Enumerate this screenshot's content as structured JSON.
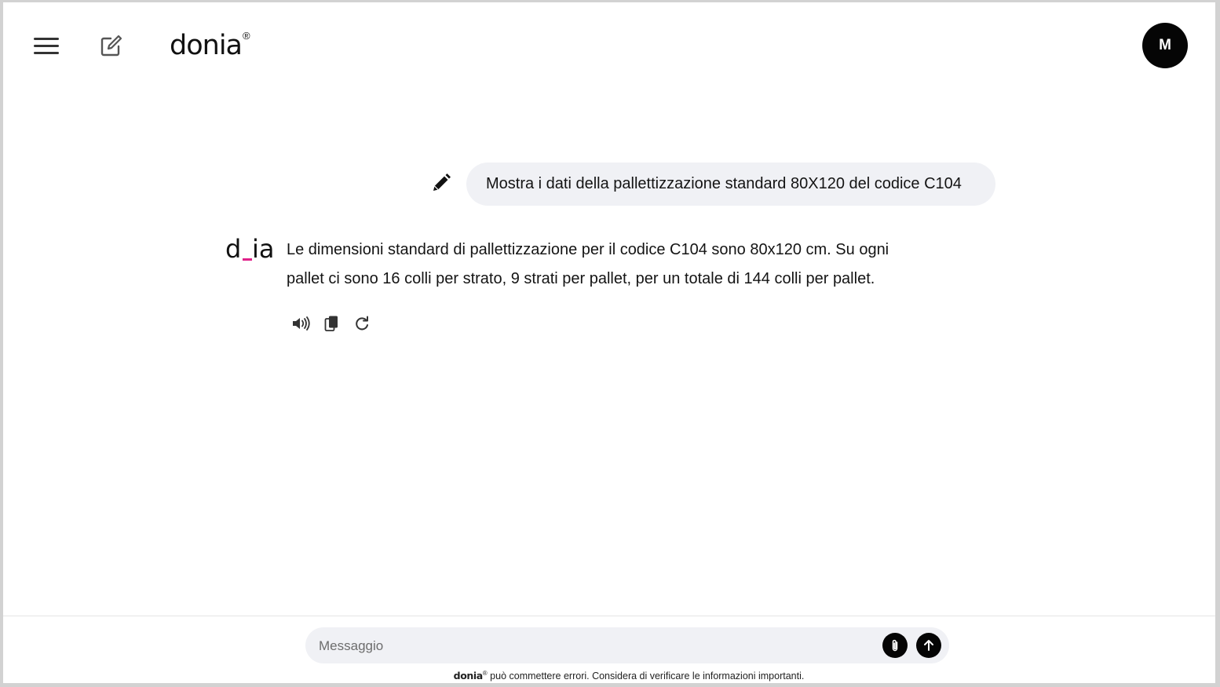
{
  "header": {
    "logo_text": "donia",
    "logo_reg": "®",
    "avatar_initial": "M",
    "icons": {
      "menu": "hamburger-icon",
      "compose": "compose-icon"
    }
  },
  "chat": {
    "user_message": "Mostra i dati della pallettizzazione standard 80X120 del codice C104",
    "assistant_logo": "d_ia",
    "assistant_message": "Le dimensioni standard di pallettizzazione per il codice C104 sono 80x120 cm. Su ogni pallet ci sono 16 colli per strato, 9 strati per pallet, per un totale di 144 colli per pallet.",
    "actions": [
      "speaker-icon",
      "copy-icon",
      "regenerate-icon"
    ]
  },
  "composer": {
    "placeholder": "Messaggio",
    "attach_icon": "paperclip-icon",
    "send_icon": "send-arrow-icon"
  },
  "footer": {
    "brand": "donia",
    "reg": "®",
    "disclaimer": " può commettere errori. Considera di verificare le informazioni importanti."
  },
  "colors": {
    "accent": "#e0218a",
    "bubble": "#f0f1f5",
    "dark": "#050505"
  }
}
